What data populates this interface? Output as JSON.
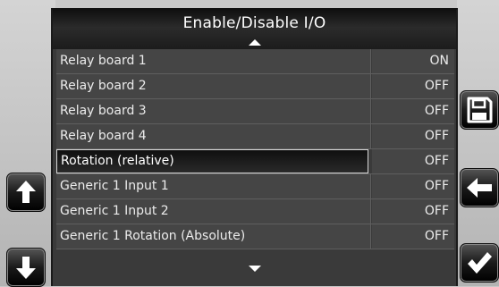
{
  "header": {
    "title": "Enable/Disable I/O"
  },
  "io_list": [
    {
      "name": "Relay board 1",
      "state": "ON"
    },
    {
      "name": "Relay board 2",
      "state": "OFF"
    },
    {
      "name": "Relay board 3",
      "state": "OFF"
    },
    {
      "name": "Relay board 4",
      "state": "OFF"
    },
    {
      "name": "Rotation (relative)",
      "state": "OFF",
      "selected": true
    },
    {
      "name": "Generic 1 Input 1",
      "state": "OFF"
    },
    {
      "name": "Generic 1 Input 2",
      "state": "OFF"
    },
    {
      "name": "Generic 1 Rotation (Absolute)",
      "state": "OFF"
    }
  ],
  "icons": {
    "up": "arrow-up-icon",
    "down": "arrow-down-icon",
    "save": "floppy-disk-icon",
    "back": "arrow-left-icon",
    "confirm": "checkmark-icon",
    "scroll_up": "triangle-up-icon",
    "scroll_down": "triangle-down-icon"
  },
  "colors": {
    "panel_bg": "#3a3a3a",
    "row_bg": "#454545",
    "text": "#ececec",
    "side_bg": "#c9c9c9",
    "button_bg": "#1a1a1a"
  }
}
